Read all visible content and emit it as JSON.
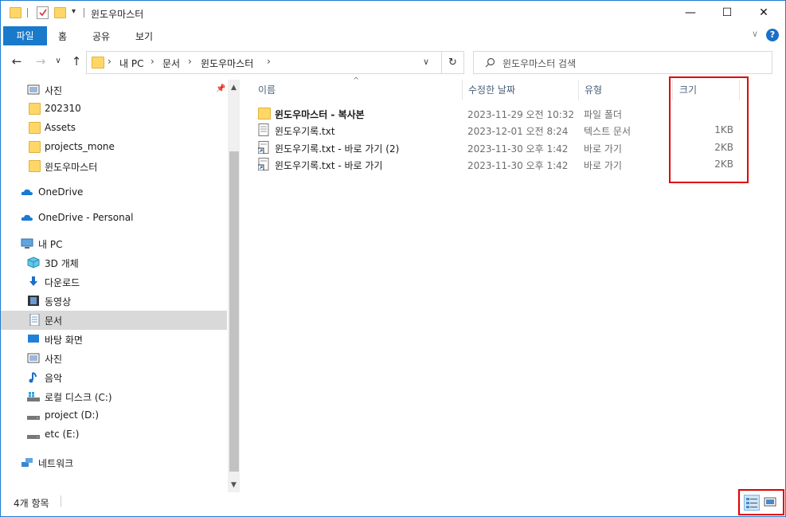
{
  "window": {
    "title": "윈도우마스터",
    "controls": {
      "minimize": "—",
      "maximize": "☐",
      "close": "✕"
    }
  },
  "ribbon": {
    "file_tab": "파일",
    "tabs": [
      "홈",
      "공유",
      "보기"
    ],
    "help": "?"
  },
  "address": {
    "crumbs": [
      "내 PC",
      "문서",
      "윈도우마스터"
    ],
    "search_placeholder": "윈도우마스터 검색"
  },
  "sidebar": {
    "items": [
      {
        "label": "사진",
        "icon": "pictures-icon"
      },
      {
        "label": "202310",
        "icon": "folder-icon"
      },
      {
        "label": "Assets",
        "icon": "folder-icon"
      },
      {
        "label": "projects_mone",
        "icon": "folder-icon"
      },
      {
        "label": "윈도우마스터",
        "icon": "folder-icon"
      },
      {
        "label": "OneDrive",
        "icon": "cloud-icon"
      },
      {
        "label": "OneDrive - Personal",
        "icon": "cloud-icon"
      },
      {
        "label": "내 PC",
        "icon": "computer-icon"
      },
      {
        "label": "3D 개체",
        "icon": "3d-objects-icon"
      },
      {
        "label": "다운로드",
        "icon": "download-icon"
      },
      {
        "label": "동영상",
        "icon": "video-icon"
      },
      {
        "label": "문서",
        "icon": "documents-icon"
      },
      {
        "label": "바탕 화면",
        "icon": "desktop-icon"
      },
      {
        "label": "사진",
        "icon": "pictures-icon"
      },
      {
        "label": "음악",
        "icon": "music-icon"
      },
      {
        "label": "로컬 디스크 (C:)",
        "icon": "system-drive-icon"
      },
      {
        "label": "project (D:)",
        "icon": "drive-icon"
      },
      {
        "label": "etc (E:)",
        "icon": "drive-icon"
      },
      {
        "label": "네트워크",
        "icon": "network-icon"
      }
    ],
    "selected": "문서"
  },
  "table": {
    "columns": [
      "이름",
      "수정한 날짜",
      "유형",
      "크기"
    ],
    "rows": [
      {
        "name": "윈도우마스터 - 복사본",
        "date": "2023-11-29 오전 10:32",
        "type": "파일 폴더",
        "size": "",
        "icon": "folder-icon"
      },
      {
        "name": "윈도우기록.txt",
        "date": "2023-12-01 오전 8:24",
        "type": "텍스트 문서",
        "size": "1KB",
        "icon": "text-file-icon"
      },
      {
        "name": "윈도우기록.txt - 바로 가기 (2)",
        "date": "2023-11-30 오후 1:42",
        "type": "바로 가기",
        "size": "2KB",
        "icon": "shortcut-icon"
      },
      {
        "name": "윈도우기록.txt - 바로 가기",
        "date": "2023-11-30 오후 1:42",
        "type": "바로 가기",
        "size": "2KB",
        "icon": "shortcut-icon"
      }
    ]
  },
  "status": {
    "item_count": "4개 항목"
  },
  "colors": {
    "accent": "#1979ca",
    "highlight": "#e00000",
    "folder": "#ffd766"
  }
}
